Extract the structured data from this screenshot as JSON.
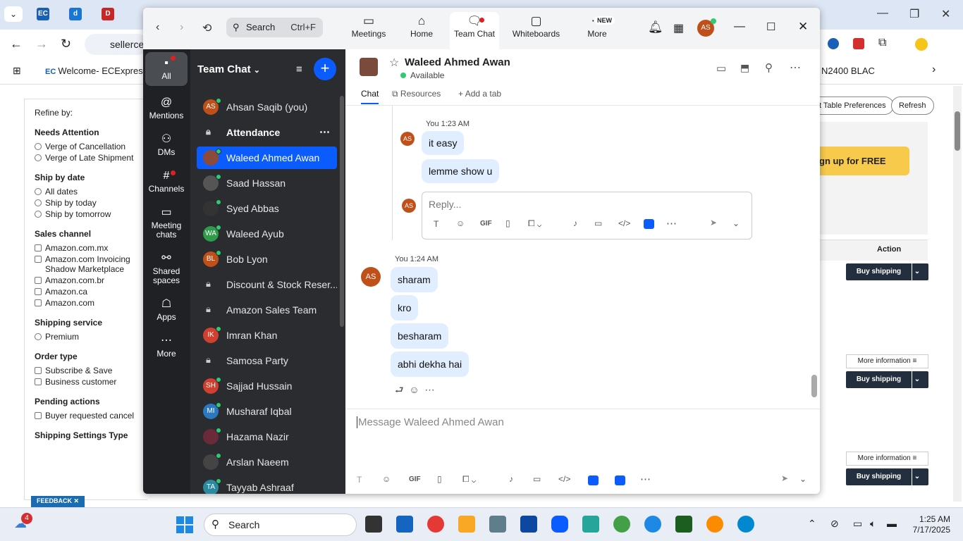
{
  "browser": {
    "address_text": "sellerce",
    "bookmark_label": "Welcome- ECExpres",
    "right_bookmark": "N2400 BLAC"
  },
  "seller_page": {
    "refine_by": "Refine by:",
    "needs_attention": {
      "title": "Needs Attention",
      "options": [
        "Verge of Cancellation",
        "Verge of Late Shipment"
      ]
    },
    "ship_by_date": {
      "title": "Ship by date",
      "options": [
        "All dates",
        "Ship by today",
        "Ship by tomorrow"
      ]
    },
    "sales_channel": {
      "title": "Sales channel",
      "options": [
        "Amazon.com.mx",
        "Amazon.com Invoicing Shadow Marketplace",
        "Amazon.com.br",
        "Amazon.ca",
        "Amazon.com"
      ]
    },
    "shipping_service": {
      "title": "Shipping service",
      "options": [
        "Premium"
      ]
    },
    "order_type": {
      "title": "Order type",
      "options": [
        "Subscribe & Save",
        "Business customer"
      ]
    },
    "pending_actions": {
      "title": "Pending actions",
      "options": [
        "Buyer requested cancel"
      ]
    },
    "shipping_settings": "Shipping Settings Type",
    "feedback": "FEEDBACK",
    "table_prefs": "t Table Preferences",
    "refresh": "Refresh",
    "signup": "gn up for FREE",
    "action_header": "Action",
    "buy_shipping": "Buy shipping",
    "more_info": "More information"
  },
  "zoom": {
    "search_placeholder": "Search",
    "search_shortcut": "Ctrl+F",
    "top_tabs": [
      {
        "label": "Meetings"
      },
      {
        "label": "Home"
      },
      {
        "label": "Team Chat"
      },
      {
        "label": "Whiteboards"
      },
      {
        "label": "More",
        "badge": "NEW"
      }
    ],
    "profile_initials": "AS",
    "rail": [
      "All",
      "Mentions",
      "DMs",
      "Channels",
      "Meeting chats",
      "Shared spaces",
      "Apps",
      "More"
    ],
    "list_title": "Team Chat",
    "contacts": [
      {
        "name": "Ahsan Saqib (you)",
        "initials": "AS",
        "color": "#c0501a"
      },
      {
        "name": "Attendance",
        "lock": true
      },
      {
        "name": "Waleed Ahmed Awan",
        "initials": "",
        "color": "#8b4a3a"
      },
      {
        "name": "Saad Hassan",
        "initials": "",
        "color": "#555"
      },
      {
        "name": "Syed Abbas",
        "initials": "",
        "color": "#333"
      },
      {
        "name": "Waleed Ayub",
        "initials": "WA",
        "color": "#2e9a4a"
      },
      {
        "name": "Bob Lyon",
        "initials": "BL",
        "color": "#c0501a"
      },
      {
        "name": "Discount & Stock Reser...",
        "lock": true
      },
      {
        "name": "Amazon Sales Team",
        "lock": true
      },
      {
        "name": "Imran Khan",
        "initials": "IK",
        "color": "#d04030"
      },
      {
        "name": "Samosa Party",
        "lock": true
      },
      {
        "name": "Sajjad Hussain",
        "initials": "SH",
        "color": "#d04030"
      },
      {
        "name": "Musharaf Iqbal",
        "initials": "MI",
        "color": "#2a78c0"
      },
      {
        "name": "Hazama Nazir",
        "initials": "",
        "color": "#6a2a3a"
      },
      {
        "name": "Arslan Naeem",
        "initials": "",
        "color": "#444"
      },
      {
        "name": "Tayyab Ashraaf",
        "initials": "TA",
        "color": "#2a8aa0"
      }
    ],
    "chat": {
      "name": "Waleed Ahmed Awan",
      "status": "Available",
      "tabs": [
        "Chat",
        "Resources",
        "Add a tab"
      ],
      "thread_meta": "You 1:23 AM",
      "thread_messages": [
        "it easy",
        "lemme show u"
      ],
      "reply_placeholder": "Reply...",
      "main_meta": "You 1:24 AM",
      "main_messages": [
        "sharam",
        "kro",
        "besharam",
        "abhi dekha hai"
      ],
      "composer_placeholder": "Message Waleed Ahmed Awan",
      "gif": "GIF"
    }
  },
  "taskbar": {
    "search": "Search",
    "notif_count": "4",
    "time": "1:25 AM",
    "date": "7/17/2025"
  }
}
